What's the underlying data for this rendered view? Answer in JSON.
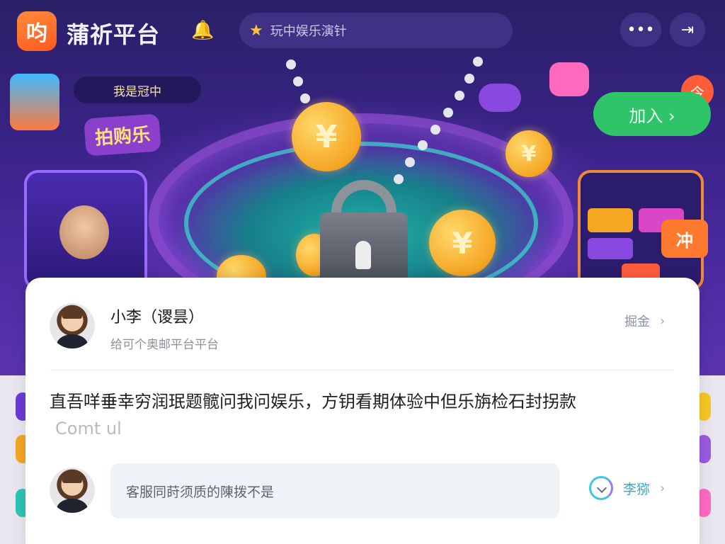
{
  "header": {
    "logo_glyph": "呁",
    "app_title": "蒲祈平台",
    "search_placeholder": "玩中娱乐演针",
    "more_glyph": "•••",
    "exit_glyph": "⇥"
  },
  "banner": {
    "top_badge": "我是冠中",
    "promo_label": "拍购乐",
    "join_button": "加入 ›",
    "red_badge": "今",
    "orange_tag": "冲",
    "coin_glyph": "¥"
  },
  "comment": {
    "user_name": "小李（谡昙）",
    "user_subtitle": "给可个奥邮平台平台",
    "follow_label": "掘金",
    "text": "直吾咩垂幸穷润珉题髋问我问娱乐，方钥看期体验中但乐旃检石封拐款",
    "more_label": "Comt ul"
  },
  "reply": {
    "placeholder": "客服同莳须质的陳拨不是",
    "action_label": "李猕"
  },
  "colors": {
    "accent_green": "#2fc46a",
    "accent_orange": "#ff5a1f",
    "link_cyan": "#3aa7c8"
  }
}
